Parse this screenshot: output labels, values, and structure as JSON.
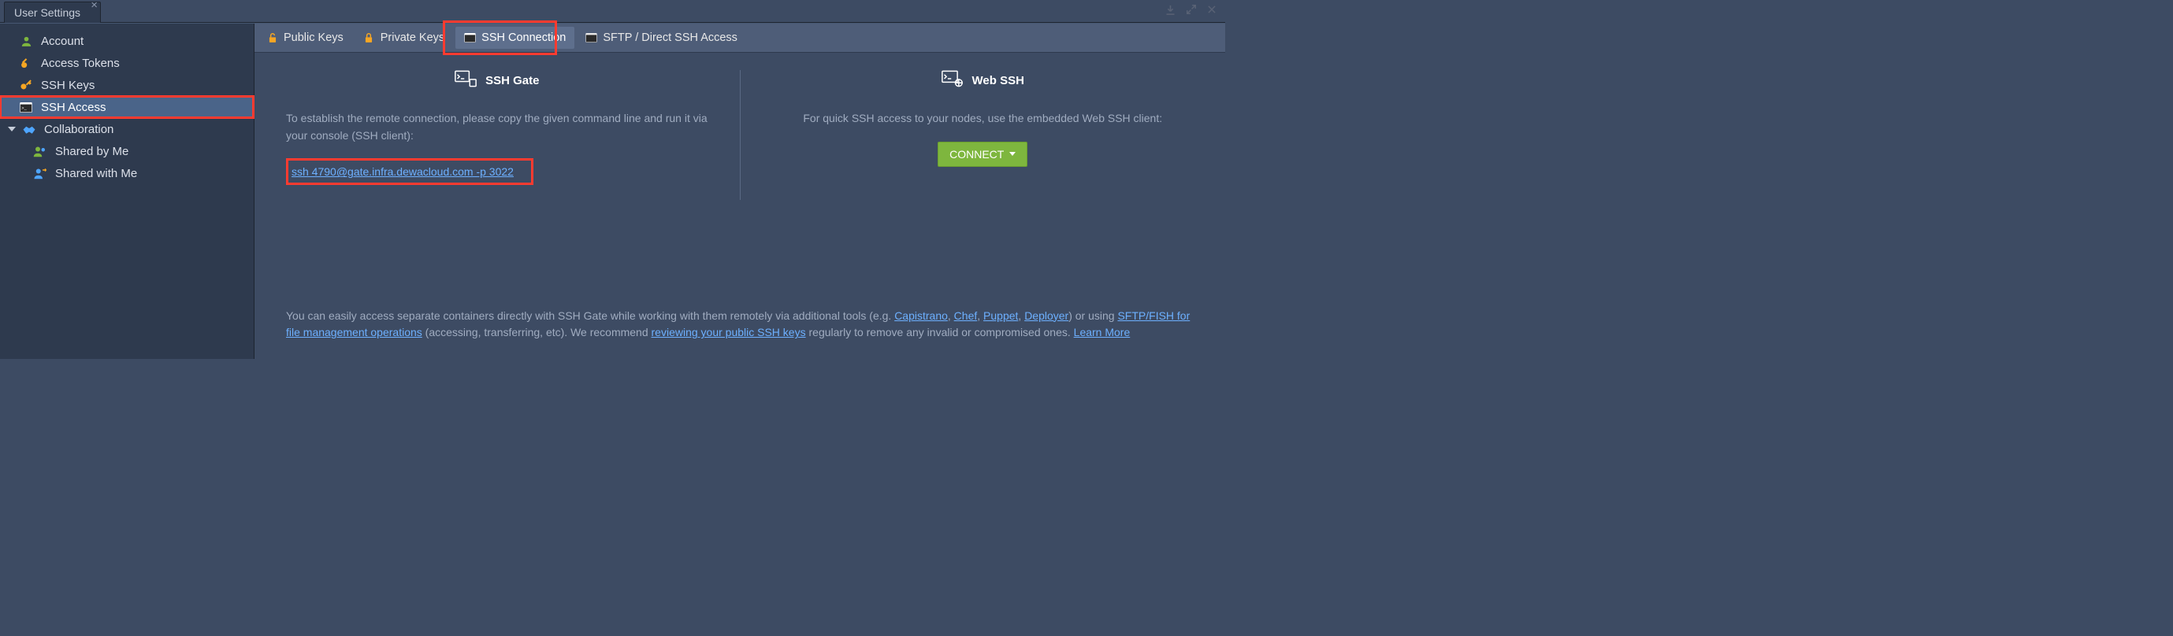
{
  "window": {
    "title": "User Settings"
  },
  "titlebar_actions": {
    "download": "⭳",
    "expand": "⤢",
    "close": "✕"
  },
  "sidebar": {
    "items": [
      {
        "label": "Account"
      },
      {
        "label": "Access Tokens"
      },
      {
        "label": "SSH Keys"
      },
      {
        "label": "SSH Access"
      },
      {
        "label": "Collaboration"
      },
      {
        "label": "Shared by Me"
      },
      {
        "label": "Shared with Me"
      }
    ]
  },
  "tabs": [
    {
      "label": "Public Keys"
    },
    {
      "label": "Private Keys"
    },
    {
      "label": "SSH Connection"
    },
    {
      "label": "SFTP / Direct SSH Access"
    }
  ],
  "ssh_gate": {
    "title": "SSH Gate",
    "desc": "To establish the remote connection, please copy the given command line and run it via your console (SSH client):",
    "command": "ssh 4790@gate.infra.dewacloud.com -p 3022"
  },
  "web_ssh": {
    "title": "Web SSH",
    "desc": "For quick SSH access to your nodes, use the embedded Web SSH client:",
    "button": "CONNECT"
  },
  "footer": {
    "t1": "You can easily access separate containers directly with SSH Gate while working with them remotely via additional tools (e.g. ",
    "l1": "Capistrano",
    "c1": ", ",
    "l2": "Chef",
    "c2": ", ",
    "l3": "Puppet",
    "c3": ", ",
    "l4": "Deployer",
    "t2": ") or using ",
    "l5": "SFTP/FISH for file management operations",
    "t3": " (accessing, transferring, etc). We recommend ",
    "l6": "reviewing your public SSH keys",
    "t4": " regularly to remove any invalid or compromised ones. ",
    "l7": "Learn More"
  }
}
